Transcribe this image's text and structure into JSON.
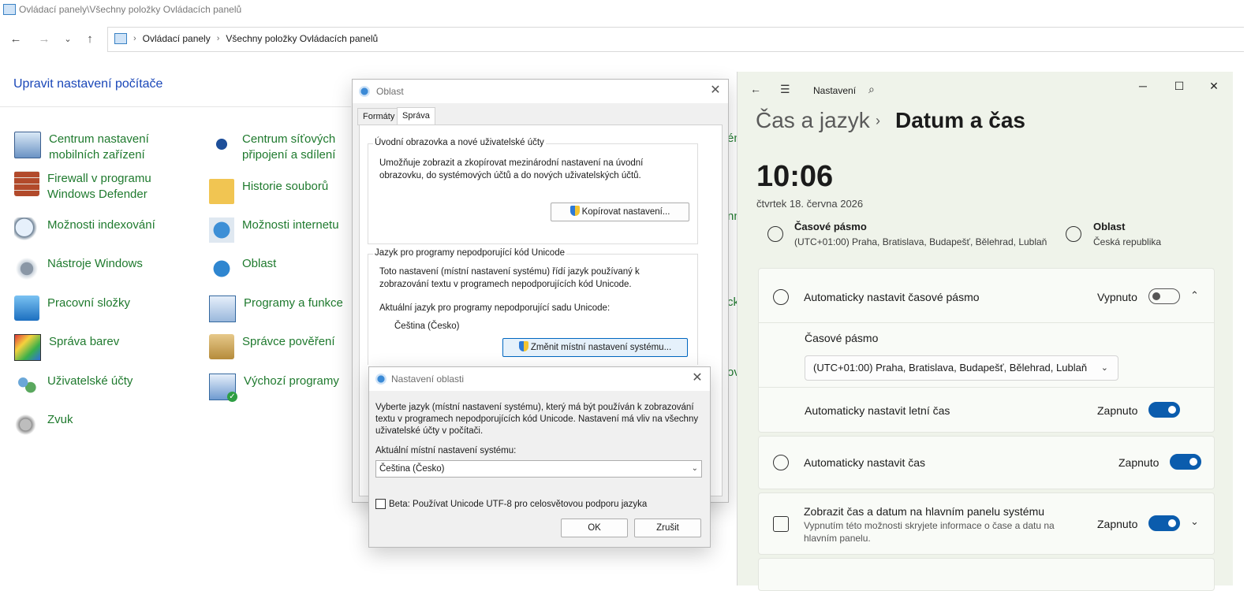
{
  "control_panel": {
    "window_title": "Ovládací panely\\Všechny položky Ovládacích panelů",
    "breadcrumb": [
      "Ovládací panely",
      "Všechny položky Ovládacích panelů"
    ],
    "heading": "Upravit nastavení počítače",
    "items_col1": [
      {
        "label": "Centrum nastavení\nmobilních zařízení",
        "icon": "mobility-center-icon"
      },
      {
        "label": "Firewall v programu\nWindows Defender",
        "icon": "firewall-icon"
      },
      {
        "label": "Možnosti indexování",
        "icon": "indexing-icon"
      },
      {
        "label": "Nástroje Windows",
        "icon": "windows-tools-icon"
      },
      {
        "label": "Pracovní složky",
        "icon": "work-folders-icon"
      },
      {
        "label": "Správa barev",
        "icon": "color-management-icon"
      },
      {
        "label": "Uživatelské účty",
        "icon": "user-accounts-icon"
      },
      {
        "label": "Zvuk",
        "icon": "sound-icon"
      }
    ],
    "items_col2": [
      {
        "label": "Centrum síťových\npřipojení a sdílení",
        "icon": "network-center-icon"
      },
      {
        "label": "Historie souborů",
        "icon": "file-history-icon"
      },
      {
        "label": "Možnosti internetu",
        "icon": "internet-options-icon"
      },
      {
        "label": "Oblast",
        "icon": "region-icon"
      },
      {
        "label": "Programy a funkce",
        "icon": "programs-icon"
      },
      {
        "label": "Správce pověření",
        "icon": "credential-manager-icon"
      },
      {
        "label": "Výchozí programy",
        "icon": "default-programs-icon"
      }
    ],
    "edge_fragments": [
      "én",
      "nn",
      "ck",
      "ov"
    ]
  },
  "region_dialog": {
    "title": "Oblast",
    "tabs": [
      "Formáty",
      "Správa"
    ],
    "active_tab": "Správa",
    "group1": {
      "title": "Úvodní obrazovka a nové uživatelské účty",
      "text": "Umožňuje zobrazit a zkopírovat mezinárodní nastavení na úvodní obrazovku, do systémových účtů a do nových uživatelských účtů.",
      "button": "Kopírovat nastavení..."
    },
    "group2": {
      "title": "Jazyk pro programy nepodporující kód Unicode",
      "text": "Toto nastavení (místní nastavení systému) řídí jazyk používaný k zobrazování textu v programech nepodporujících kód Unicode.",
      "current_label": "Aktuální jazyk pro programy nepodporující sadu Unicode:",
      "current_value": "Čeština (Česko)",
      "button": "Změnit místní nastavení systému..."
    }
  },
  "locale_dialog": {
    "title": "Nastavení oblasti",
    "description": "Vyberte jazyk (místní nastavení systému), který má být používán k zobrazování textu v programech nepodporujících kód Unicode. Nastavení má vliv na všechny uživatelské účty v počítači.",
    "current_label": "Aktuální místní nastavení systému:",
    "selected_locale": "Čeština (Česko)",
    "beta_label": "Beta: Používat Unicode UTF-8 pro celosvětovou podporu jazyka",
    "beta_checked": false,
    "ok": "OK",
    "cancel": "Zrušit"
  },
  "settings": {
    "app_title": "Nastavení",
    "breadcrumb_parent": "Čas a jazyk",
    "breadcrumb_current": "Datum a čas",
    "time": "10:06",
    "date": "čtvrtek 18. června 2026",
    "timezone_title": "Časové pásmo",
    "timezone_value": "(UTC+01:00) Praha, Bratislava, Budapešť, Bělehrad, Lublaň",
    "region_title": "Oblast",
    "region_value": "Česká republika",
    "rows": {
      "auto_tz": {
        "label": "Automaticky nastavit časové pásmo",
        "state": "Vypnuto",
        "on": false
      },
      "tz_section_label": "Časové pásmo",
      "tz_dropdown": "(UTC+01:00) Praha, Bratislava, Budapešť, Bělehrad, Lublaň",
      "auto_dst": {
        "label": "Automaticky nastavit letní čas",
        "state": "Zapnuto",
        "on": true
      },
      "auto_time": {
        "label": "Automaticky nastavit čas",
        "state": "Zapnuto",
        "on": true
      },
      "show_taskbar": {
        "label": "Zobrazit čas a datum na hlavním panelu systému",
        "sub": "Vypnutím této možnosti skryjete informace o čase a datu na hlavním panelu.",
        "state": "Zapnuto",
        "on": true
      }
    },
    "accent_color": "#0b5cad"
  }
}
